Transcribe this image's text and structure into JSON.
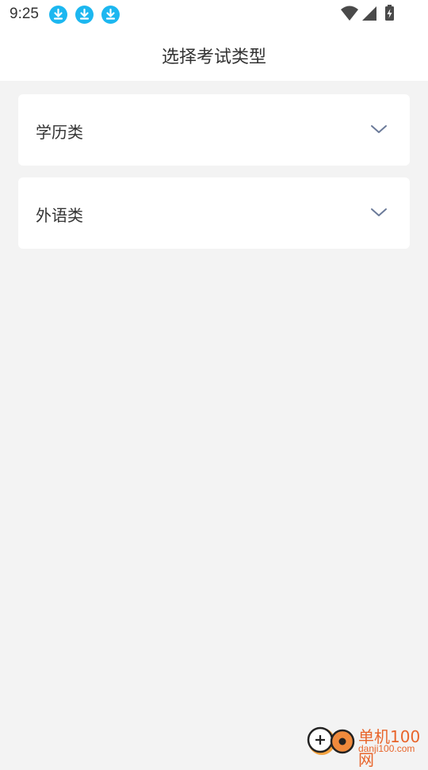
{
  "status_bar": {
    "time": "9:25",
    "notification_icons": [
      "download-icon",
      "download-icon",
      "download-icon"
    ],
    "system_icons": [
      "wifi-icon",
      "cell-signal-icon",
      "battery-charging-icon"
    ]
  },
  "header": {
    "title": "选择考试类型"
  },
  "categories": [
    {
      "label": "学历类",
      "icon": "chevron-down-icon"
    },
    {
      "label": "外语类",
      "icon": "chevron-down-icon"
    }
  ],
  "watermark": {
    "title": "单机100网",
    "url": "danji100.com"
  },
  "colors": {
    "background": "#f3f3f3",
    "surface": "#ffffff",
    "text": "#333333",
    "download_icon": "#1cb7f0",
    "chevron": "#6b7a99",
    "watermark": "#e8652b"
  }
}
